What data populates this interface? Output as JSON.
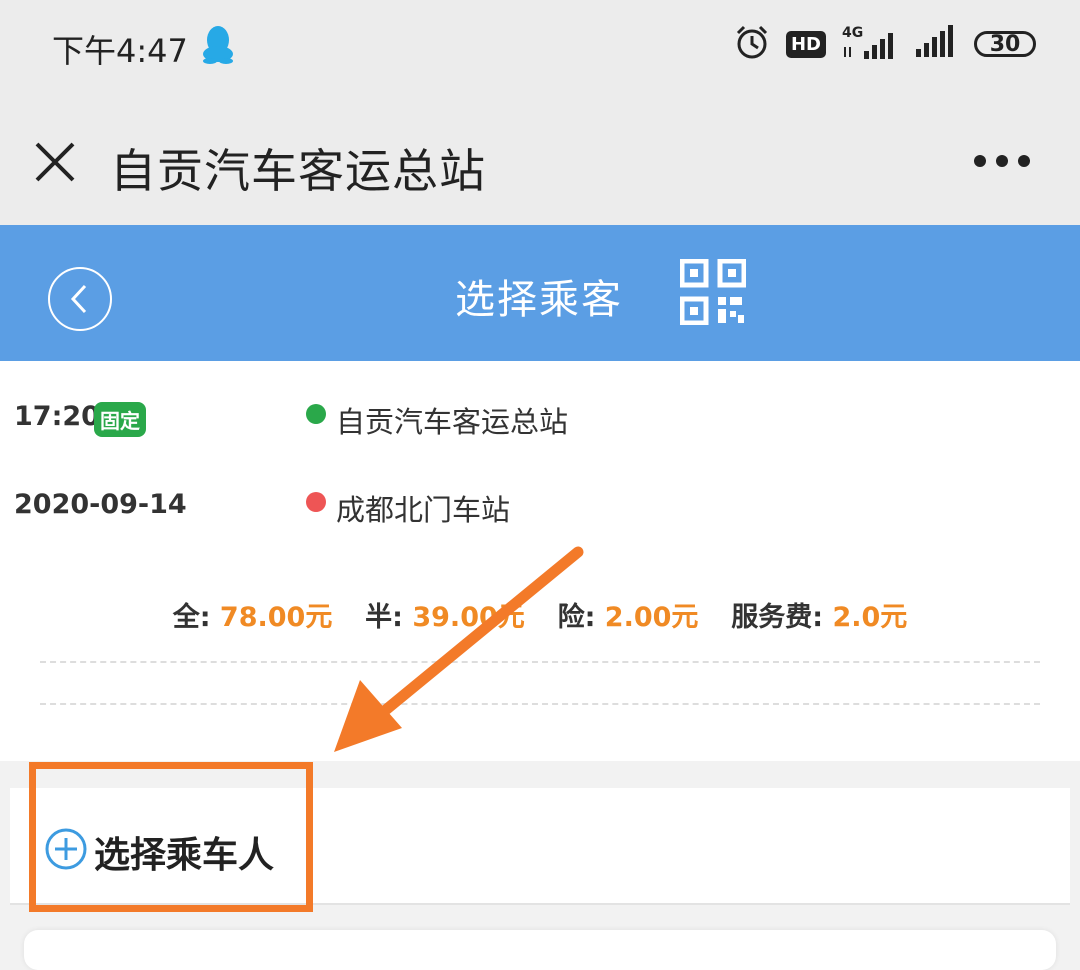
{
  "status_bar": {
    "time": "下午4:47",
    "hd": "HD",
    "network": "4G",
    "battery": "30"
  },
  "nav_bar": {
    "title": "自贡汽车客运总站"
  },
  "header": {
    "title": "选择乘客"
  },
  "trip": {
    "time": "17:20",
    "badge": "固定",
    "date": "2020-09-14",
    "origin": "自贡汽车客运总站",
    "destination": "成都北门车站"
  },
  "prices": {
    "full_label": "全:",
    "full_value": "78.00元",
    "half_label": "半:",
    "half_value": "39.00元",
    "insurance_label": "险:",
    "insurance_value": "2.00元",
    "service_label": "服务费:",
    "service_value": "2.0元"
  },
  "passenger": {
    "select_label": "选择乘车人"
  },
  "colors": {
    "header_blue": "#5b9ee4",
    "price_orange": "#f08a24",
    "badge_green": "#2aa84a",
    "origin_dot": "#2aa84a",
    "dest_dot": "#ee5555",
    "annotation": "#f37a29"
  }
}
